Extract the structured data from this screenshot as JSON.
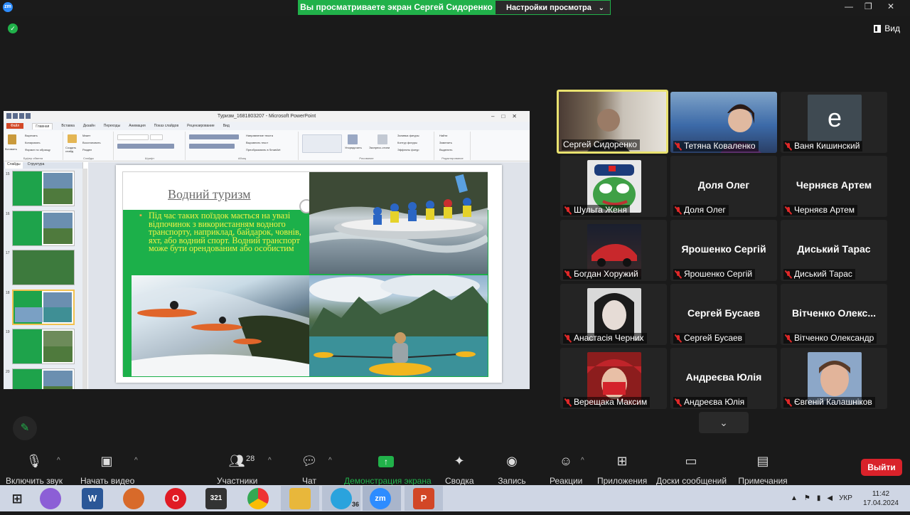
{
  "window": {
    "app_logo": "zm",
    "share_banner": "Вы просматриваете экран Сергей Сидоренко",
    "view_settings": "Настройки просмотра",
    "view_button": "Вид"
  },
  "powerpoint": {
    "title": "Туризм_1681803207 - Microsoft PowerPoint",
    "tabs": [
      "Файл",
      "Главная",
      "Вставка",
      "Дизайн",
      "Переходы",
      "Анимация",
      "Показ слайдов",
      "Рецензирование",
      "Вид"
    ],
    "ribbon": {
      "paste": "Вставить",
      "cut": "Вырезать",
      "copy": "Копировать",
      "format_painter": "Формат по образцу",
      "clipboard_group": "Буфер обмена",
      "new_slide": "Создать слайд",
      "layout": "Макет",
      "reset": "Восстановить",
      "section": "Раздел",
      "slides_group": "Слайды",
      "font_group": "Шрифт",
      "text_direction": "Направление текста",
      "align_text": "Выровнять текст",
      "convert_smartart": "Преобразовать в SmartArt",
      "paragraph_group": "Абзац",
      "arrange": "Упорядочить",
      "quick_styles": "Экспресс-стили",
      "shape_fill": "Заливка фигуры",
      "shape_outline": "Контур фигуры",
      "shape_effects": "Эффекты фигур",
      "drawing_group": "Рисование",
      "find": "Найти",
      "replace": "Заменить",
      "select": "Выделить",
      "editing_group": "Редактирование"
    },
    "left_tabs": [
      "Слайды",
      "Структура"
    ],
    "thumbnails": [
      "15",
      "16",
      "17",
      "18",
      "19",
      "20"
    ],
    "slide": {
      "title": "Водний туризм",
      "body": "Під час таких поїздок мається на увазі відпочинок з використанням водного транспорту, наприклад, байдарок, човнів, яхт, або водний спорт. Водний транспорт може бути орендованим або особистим"
    }
  },
  "participants": [
    {
      "name": "Сергей Сидоренко",
      "label": "Сергей Сидоренко",
      "video": true,
      "active": true,
      "muted": false
    },
    {
      "name": "Тетяна Коваленко",
      "label": "Тетяна  Коваленко",
      "video": true,
      "muted": true
    },
    {
      "name": "Ваня Кишинский",
      "label": "Ваня Кишинский",
      "avatar_letter": "e",
      "muted": true
    },
    {
      "name": "Шульга Женя",
      "label": "Шульга Женя",
      "video": true,
      "muted": true
    },
    {
      "name": "Доля Олег",
      "label": "Доля Олег",
      "muted": true
    },
    {
      "name": "Черняєв Артем",
      "label": "Черняєв Артем",
      "muted": true
    },
    {
      "name": "Богдан Хоружий",
      "label": "Богдан Хоружий",
      "video": true,
      "muted": true
    },
    {
      "name": "Ярошенко Сергій",
      "label": "Ярошенко Сергій",
      "muted": true
    },
    {
      "name": "Диський Тарас",
      "label": "Диський Тарас",
      "muted": true
    },
    {
      "name": "Анастасія Черних",
      "label": "Анастасія Черних",
      "video": true,
      "muted": true
    },
    {
      "name": "Сергей Бусаев",
      "label": "Сергей Бусаев",
      "muted": true
    },
    {
      "name": "Вітченко  Олекс...",
      "label": "Вітченко Олександр",
      "muted": true
    },
    {
      "name": "Верещака Максим",
      "label": "Верещака Максим",
      "video": true,
      "muted": true
    },
    {
      "name": "Андреєва Юлія",
      "label": "Андреєва Юлія",
      "muted": true
    },
    {
      "name": "Євгеній Калашніков",
      "label": "Євгеній Калашніков",
      "video": true,
      "muted": true
    }
  ],
  "toolbar": {
    "audio": "Включить звук",
    "video": "Начать видео",
    "participants": "Участники",
    "participants_count": "28",
    "chat": "Чат",
    "share": "Демонстрация экрана",
    "summary": "Сводка",
    "record": "Запись",
    "reactions": "Реакции",
    "apps": "Приложения",
    "whiteboards": "Доски сообщений",
    "notes": "Примечания",
    "leave": "Выйти"
  },
  "taskbar": {
    "telegram_badge": "36",
    "zoom_label": "zm",
    "language": "УКР",
    "time": "11:42",
    "date": "17.04.2024",
    "calendar_badge": "321"
  },
  "colors": {
    "zoom_green": "#21b14a",
    "leave_red": "#d9222a",
    "active_speaker": "#e9e26f",
    "slide_green": "#1cb04a",
    "slide_text_yellow": "#f2f246"
  }
}
